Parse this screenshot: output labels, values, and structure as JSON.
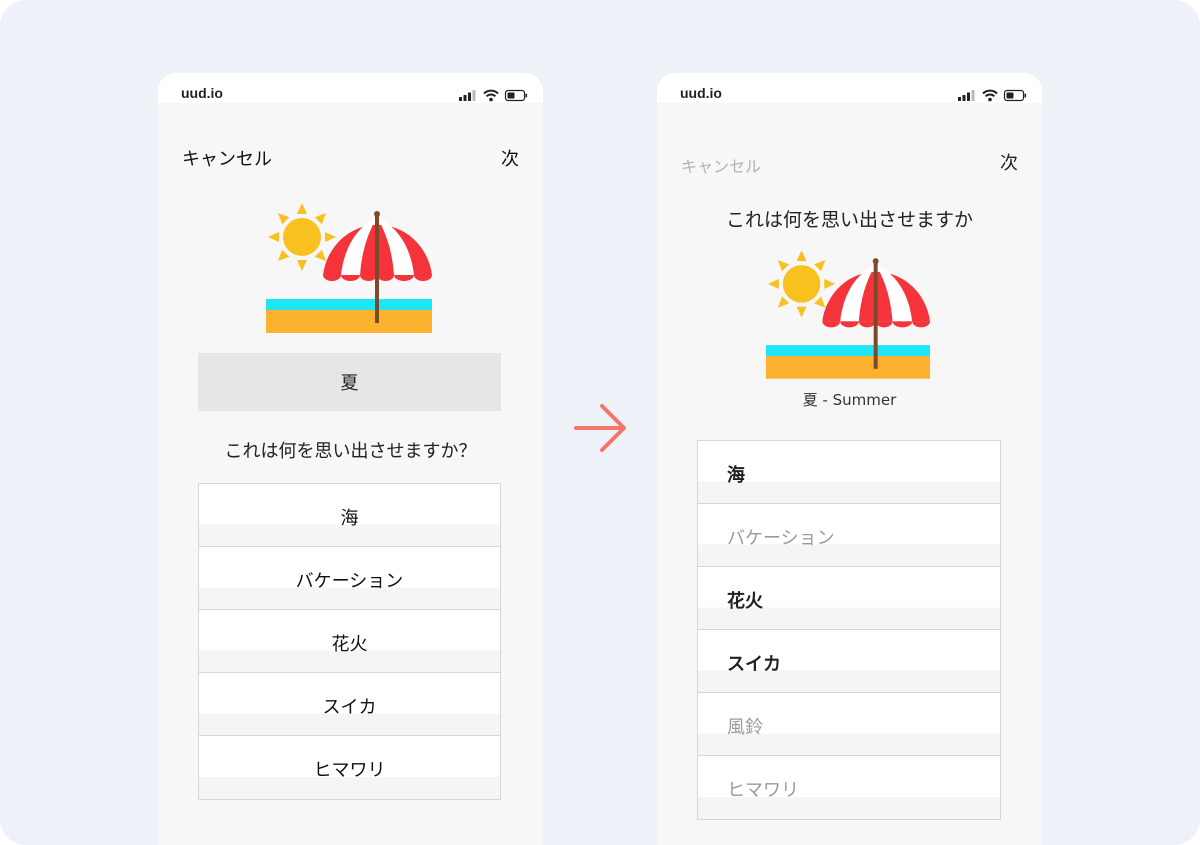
{
  "before": {
    "status": {
      "url": "uud.io"
    },
    "nav": {
      "cancel": "キャンセル",
      "next": "次"
    },
    "word": "夏",
    "question": "これは何を思い出させますか？",
    "options": [
      {
        "label": "海"
      },
      {
        "label": "バケーション"
      },
      {
        "label": "花火"
      },
      {
        "label": "スイカ"
      },
      {
        "label": "ヒマワリ"
      }
    ]
  },
  "after": {
    "status": {
      "url": "uud.io"
    },
    "nav": {
      "cancel": "キャンセル",
      "next": "次"
    },
    "question": "これは何を思い出させますか",
    "caption": "夏 - Summer",
    "options": [
      {
        "label": "海",
        "state": "selected"
      },
      {
        "label": "バケーション",
        "state": "unselected"
      },
      {
        "label": "花火",
        "state": "selected"
      },
      {
        "label": "スイカ",
        "state": "selected"
      },
      {
        "label": "風鈴",
        "state": "unselected"
      },
      {
        "label": "ヒマワリ",
        "state": "unselected"
      }
    ]
  },
  "icons": {
    "illustration": "beach-umbrella-sun-icon",
    "transition": "arrow-right-icon",
    "signal": "cellular-signal-icon",
    "wifi": "wifi-icon",
    "battery": "battery-icon"
  },
  "colors": {
    "sun": "#f8c11f",
    "umbrella_red": "#f4333a",
    "water": "#1fe6f5",
    "sand": "#fdb22f",
    "arrow": "#f47668",
    "frame": "#eef1f8"
  }
}
